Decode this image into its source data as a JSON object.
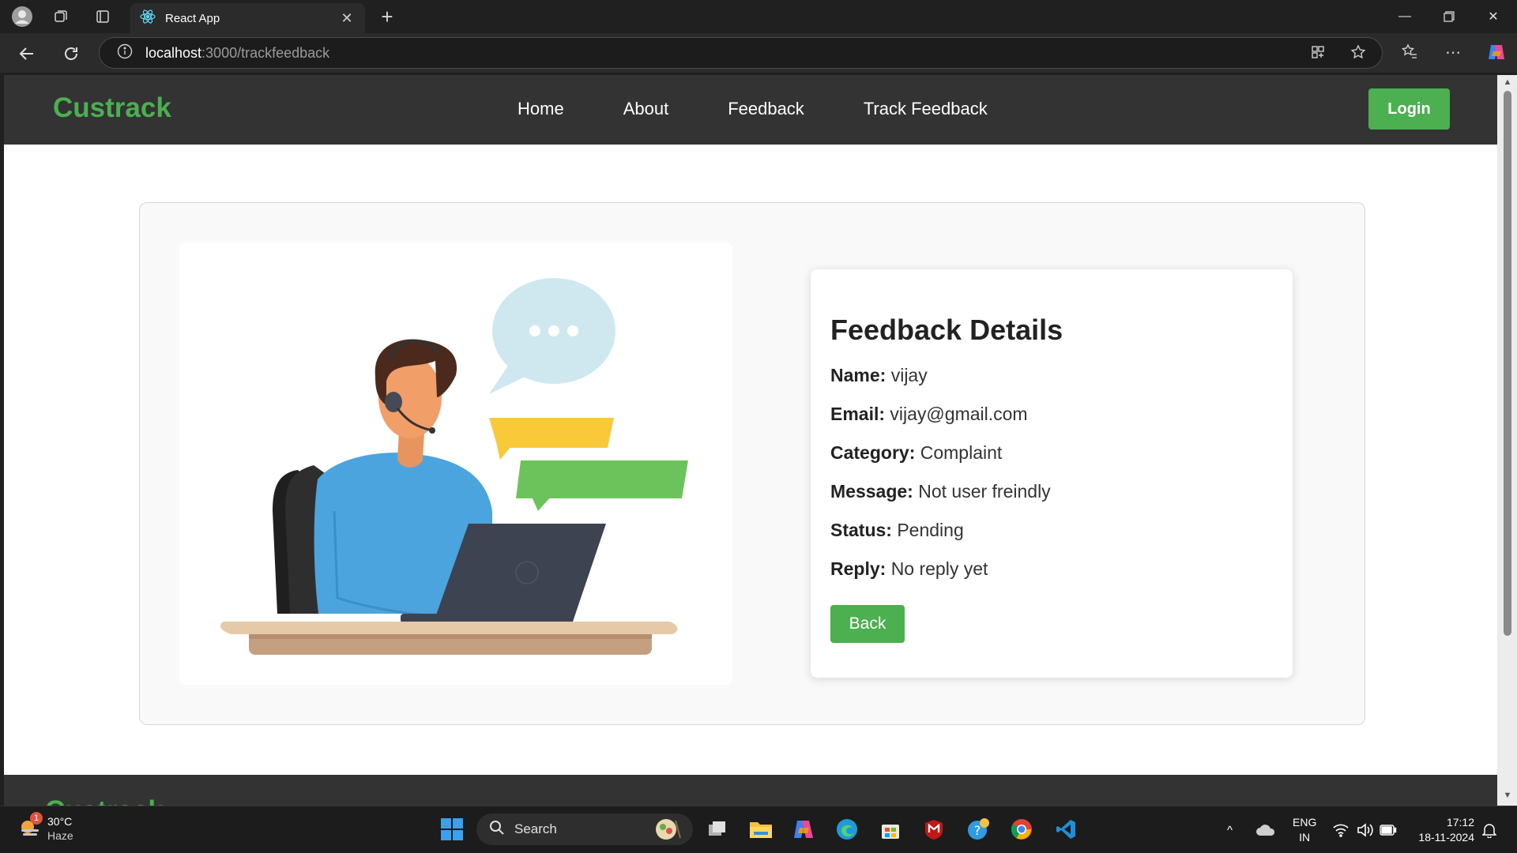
{
  "browser": {
    "tab_title": "React App",
    "url_host": "localhost",
    "url_rest": ":3000/trackfeedback"
  },
  "navbar": {
    "brand": "Custrack",
    "links": [
      "Home",
      "About",
      "Feedback",
      "Track Feedback"
    ],
    "login_label": "Login"
  },
  "details": {
    "title": "Feedback Details",
    "fields": [
      {
        "label": "Name:",
        "value": "vijay"
      },
      {
        "label": "Email:",
        "value": "vijay@gmail.com"
      },
      {
        "label": "Category:",
        "value": "Complaint"
      },
      {
        "label": "Message:",
        "value": "Not user freindly"
      },
      {
        "label": "Status:",
        "value": "Pending"
      },
      {
        "label": "Reply:",
        "value": "No reply yet"
      }
    ],
    "back_label": "Back"
  },
  "footer": {
    "brand": "Custrack"
  },
  "taskbar": {
    "weather_temp": "30°C",
    "weather_desc": "Haze",
    "weather_badge": "1",
    "search_label": "Search",
    "lang_top": "ENG",
    "lang_bottom": "IN",
    "time": "17:12",
    "date": "18-11-2024"
  },
  "colors": {
    "accent_green": "#4caf50",
    "navbar_bg": "#333333",
    "chrome_bg": "#202020"
  }
}
